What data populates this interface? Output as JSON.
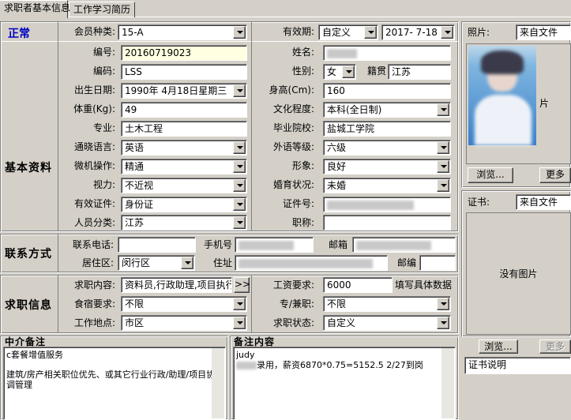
{
  "tabs": [
    "求职者基本信息",
    "工作学习简历"
  ],
  "status": "正常",
  "sections": {
    "basic": "基本资料",
    "contact": "联系方式",
    "job": "求职信息",
    "agency": "中介备注",
    "remarks": "备注内容"
  },
  "fields": {
    "member_type": {
      "label": "会员种类:",
      "value": "15-A"
    },
    "validity": {
      "label": "有效期:",
      "value": "自定义",
      "date": "2017- 7-18"
    },
    "number": {
      "label": "编号:",
      "value": "20160719023"
    },
    "name": {
      "label": "姓名:",
      "value": ""
    },
    "code": {
      "label": "编码:",
      "value": "LSS"
    },
    "gender": {
      "label": "性别:",
      "value": "女"
    },
    "native": {
      "label": "籍贯",
      "value": "江苏"
    },
    "birth": {
      "label": "出生日期:",
      "value": "1990年 4月18日星期三"
    },
    "height": {
      "label": "身高(Cm):",
      "value": "160"
    },
    "weight": {
      "label": "体重(Kg):",
      "value": "49"
    },
    "education": {
      "label": "文化程度:",
      "value": "本科(全日制)"
    },
    "major": {
      "label": "专业:",
      "value": "土木工程"
    },
    "school": {
      "label": "毕业院校:",
      "value": "盐城工学院"
    },
    "language": {
      "label": "通晓语言:",
      "value": "英语"
    },
    "foreign_level": {
      "label": "外语等级:",
      "value": "六级"
    },
    "computer": {
      "label": "微机操作:",
      "value": "精通"
    },
    "appearance": {
      "label": "形象:",
      "value": "良好"
    },
    "eyesight": {
      "label": "视力:",
      "value": "不近视"
    },
    "marital": {
      "label": "婚育状况:",
      "value": "未婚"
    },
    "id_type": {
      "label": "有效证件:",
      "value": "身份证"
    },
    "id_number": {
      "label": "证件号:",
      "value": ""
    },
    "category": {
      "label": "人员分类:",
      "value": "江苏"
    },
    "title": {
      "label": "职称:",
      "value": ""
    },
    "phone": {
      "label": "联系电话:",
      "value": ""
    },
    "mobile": {
      "label": "手机号",
      "value": ""
    },
    "email": {
      "label": "邮箱",
      "value": ""
    },
    "district": {
      "label": "居住区:",
      "value": "闵行区"
    },
    "address": {
      "label": "住址",
      "value": ""
    },
    "postcode": {
      "label": "邮编",
      "value": ""
    },
    "job_content": {
      "label": "求职内容:",
      "value": "资料员,行政助理,项目执行"
    },
    "salary": {
      "label": "工资要求:",
      "value": "6000",
      "hint": "填写具体数据"
    },
    "lodging": {
      "label": "食宿要求:",
      "value": "不限"
    },
    "parttime": {
      "label": "专/兼职:",
      "value": "不限"
    },
    "location": {
      "label": "工作地点:",
      "value": "市区"
    },
    "job_status": {
      "label": "求职状态:",
      "value": "自定义"
    }
  },
  "more_btn": ">>",
  "agency_text": [
    "c套餐增值服务",
    "",
    "建筑/房产相关职位优先、或其它行业行政/助理/项目协调管理"
  ],
  "remarks_text": [
    "judy",
    "录用，薪资6870*0.75=5152.5  2/27到岗"
  ],
  "photo": {
    "label": "照片:",
    "source": "来自文件",
    "side_char": "片",
    "browse": "浏览...",
    "more": "更多"
  },
  "cert": {
    "label": "证书:",
    "source": "来自文件",
    "empty": "没有图片",
    "browse": "浏览...",
    "more": "更多",
    "desc": "证书说明"
  }
}
